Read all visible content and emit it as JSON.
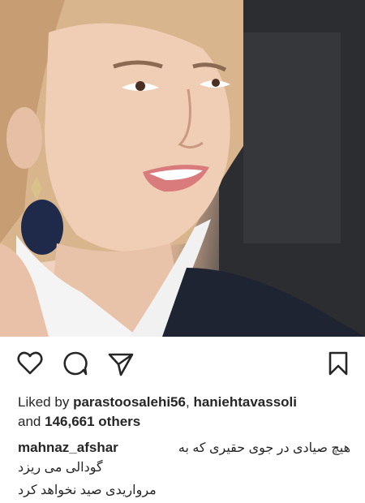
{
  "post": {
    "likes_prefix": "Liked by",
    "liker1": "parastoosalehi56",
    "liker2": "haniehtavassoli",
    "and_word": "and",
    "others_count": "146,661 others",
    "caption_user": "mahnaz_afshar",
    "caption_line1": "هیچ صیادی در جوی حقیری که به",
    "caption_line2": "گودالی می ریزد",
    "caption_line3": "مرواریدی صید نخواهد کرد"
  },
  "icons": [
    "heart-icon",
    "comment-icon",
    "share-icon",
    "bookmark-icon"
  ],
  "colors": {
    "text": "#262626",
    "background": "#ffffff"
  }
}
